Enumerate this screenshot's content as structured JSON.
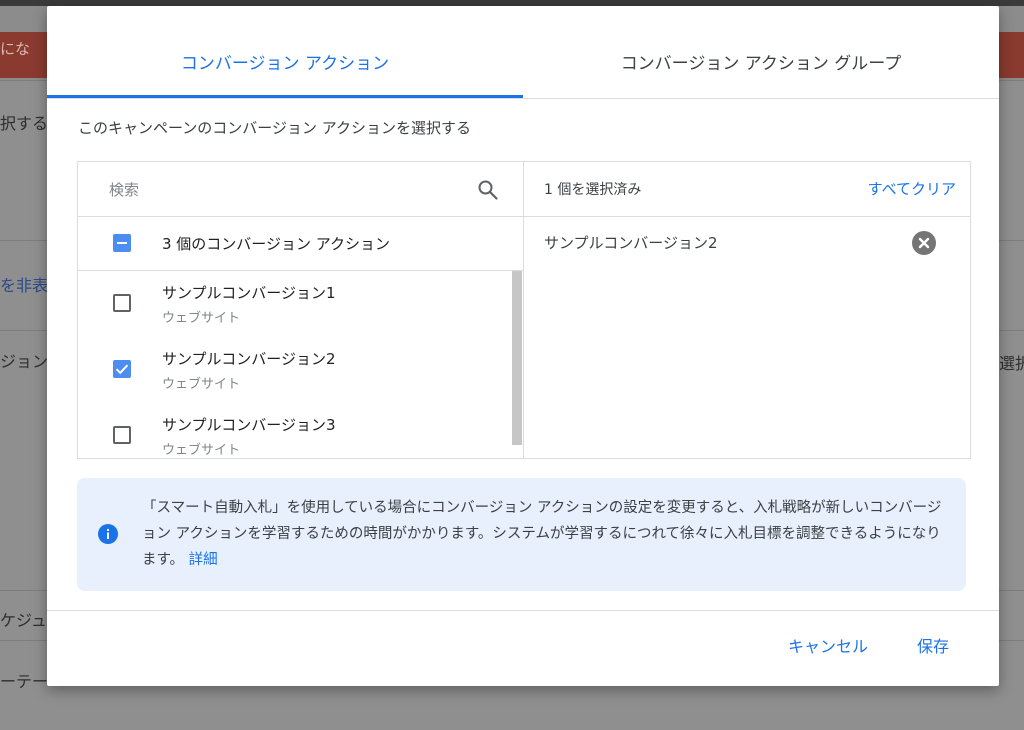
{
  "background": {
    "banner_text": "にな",
    "row1_text": "択する",
    "row2_link": "を非表示",
    "row3_text": "ジョン",
    "row3_right_text": "選択",
    "row4_text": "ケジュ",
    "row5_text": "ーテー"
  },
  "dialog": {
    "tabs": [
      {
        "label": "コンバージョン アクション",
        "active": true
      },
      {
        "label": "コンバージョン アクション グループ",
        "active": false
      }
    ],
    "instruction": "このキャンペーンのコンバージョン アクションを選択する",
    "search": {
      "placeholder": "検索",
      "value": ""
    },
    "select_all": {
      "label": "3 個のコンバージョン アクション",
      "state": "indeterminate"
    },
    "items": [
      {
        "name": "サンプルコンバージョン1",
        "type": "ウェブサイト",
        "checked": false
      },
      {
        "name": "サンプルコンバージョン2",
        "type": "ウェブサイト",
        "checked": true
      },
      {
        "name": "サンプルコンバージョン3",
        "type": "ウェブサイト",
        "checked": false
      }
    ],
    "selected_panel": {
      "count_label": "1 個を選択済み",
      "clear_all_label": "すべてクリア",
      "selected_items": [
        "サンプルコンバージョン2"
      ]
    },
    "notice": {
      "text": "「スマート自動入札」を使用している場合にコンバージョン アクションの設定を変更すると、入札戦略が新しいコンバージョン アクションを学習するための時間がかかります。システムが学習するにつれて徐々に入札目標を調整できるようになります。",
      "link": "詳細"
    },
    "buttons": {
      "cancel": "キャンセル",
      "save": "保存"
    }
  },
  "colors": {
    "accent": "#1a73e8",
    "checkbox": "#4d8cf0",
    "notice_bg": "#e8f0fe"
  }
}
